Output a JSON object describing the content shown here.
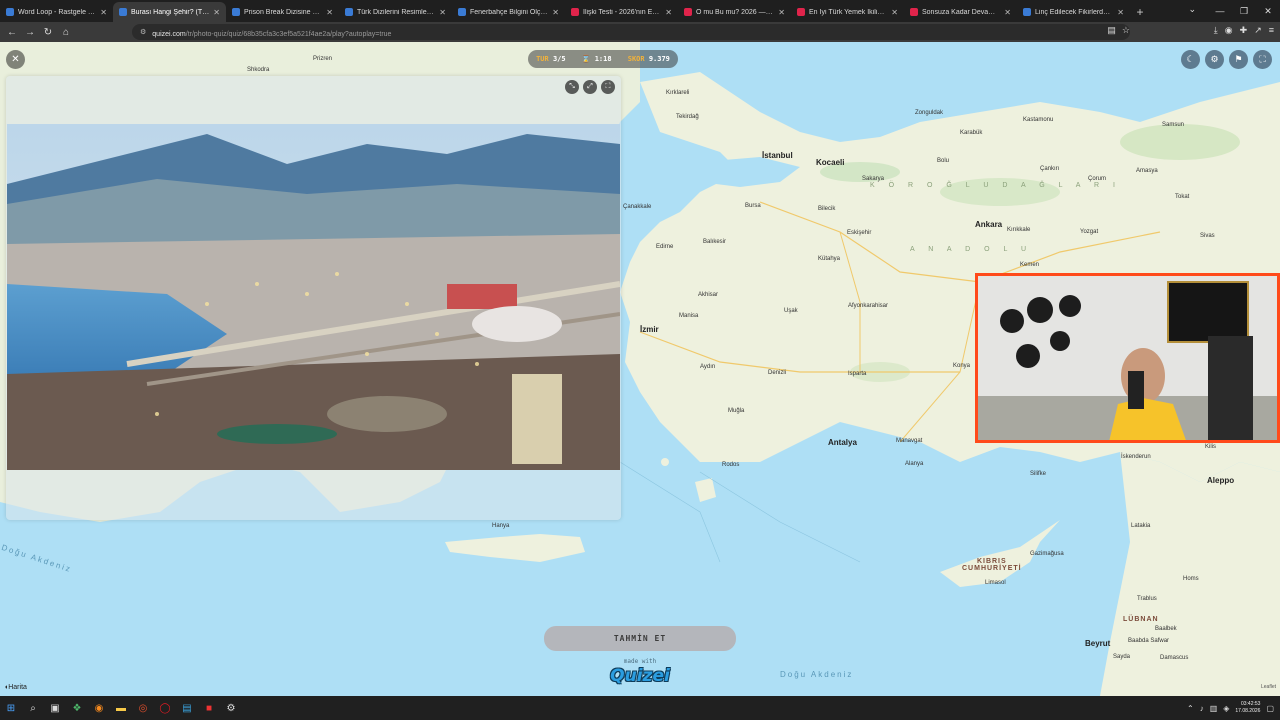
{
  "browser": {
    "tabs": [
      {
        "title": "Word Loop - Rastgele - Quizei",
        "color": "#3a7bd5",
        "active": false
      },
      {
        "title": "Burası Hangi Şehir? (Türkiye) - Q",
        "color": "#3a7bd5",
        "active": true
      },
      {
        "title": "Prison Break Dizisine Ne Kadar",
        "color": "#3a7bd5",
        "active": false
      },
      {
        "title": "Türk Dizilerini Resimlerden Tah",
        "color": "#3a7bd5",
        "active": false
      },
      {
        "title": "Fenerbahçe Bilgini Ölç - Quizei",
        "color": "#3a7bd5",
        "active": false
      },
      {
        "title": "İlişki Testi - 2026'nın En Viral Te",
        "color": "#e0244b",
        "active": false
      },
      {
        "title": "O mu Bu mu? 2026 — Sevgilini",
        "color": "#e0244b",
        "active": false
      },
      {
        "title": "En İyi Türk Yemek İkilisi Hangisi",
        "color": "#e0244b",
        "active": false
      },
      {
        "title": "Sonsuza Kadar Devam Edecek",
        "color": "#e0244b",
        "active": false
      },
      {
        "title": "Linç Edilecek Fikirlerden Hangi",
        "color": "#3a7bd5",
        "active": false
      }
    ],
    "url_host": "quizei.com",
    "url_path": "/tr/photo-quiz/quiz/68b35cfa3c3ef5a521f4ae2a/play?autoplay=true"
  },
  "hud": {
    "round_label": "TUR",
    "round_value": "3/5",
    "timer_value": "1:18",
    "score_label": "SKOR",
    "score_value": "9.379"
  },
  "guess_button": "TAHMİN ET",
  "made_with": "made with",
  "logo_text": "Quizei",
  "map_tab": "Harita",
  "attribution": "Leaflet",
  "map_labels": {
    "istanbul": "İstanbul",
    "kocaeli": "Kocaeli",
    "ankara": "Ankara",
    "izmir": "İzmir",
    "antalya": "Antalya",
    "bursa": "Bursa",
    "eskisehir": "Eskişehir",
    "balikesir": "Balıkesir",
    "konya": "Konya",
    "denizli": "Denizli",
    "aydin": "Aydın",
    "mugla": "Muğla",
    "rodos": "Rodos",
    "samsun": "Samsun",
    "aleppo": "Aleppo",
    "beyrut": "Beyrut",
    "kutahya": "Kütahya",
    "afyon": "Afyonkarahisar",
    "manisa": "Manisa",
    "edirne": "Edirne",
    "kastamonu": "Kastamonu",
    "zonguldak": "Zonguldak",
    "corum": "Çorum",
    "amasya": "Amasya",
    "tokat": "Tokat",
    "sivas": "Sivas",
    "yozgat": "Yozgat",
    "canakkale": "Çanakkale",
    "tekirdag": "Tekirdağ",
    "kirklareli": "Kırklareli",
    "isparta": "Isparta",
    "alanya": "Alanya",
    "hanya": "Hanya",
    "latakia": "Latakia",
    "homs": "Homs",
    "damascus": "Damascus",
    "limasol": "Limasol",
    "girne": "Gazimağusa",
    "iskenderun": "İskenderun",
    "kilis": "Kilis",
    "silifke": "Silifke",
    "manavgat": "Manavgat",
    "usak": "Uşak",
    "bolu": "Bolu",
    "sakarya": "Sakarya",
    "karabuk": "Karabük",
    "cankiri": "Çankırı",
    "kirikkale": "Kırıkkale",
    "bilecik": "Bilecik",
    "kemen": "Kemen",
    "akhisar": "Akhisar",
    "prizren": "Prizren",
    "skodra": "Shkodra",
    "mersin_sea": "Doğu Akdeniz",
    "west_sea": "Doğu Akdeniz",
    "region": "K Ö R O Ğ L U  D A Ğ L A R I",
    "anadolu": "A N A D O L U",
    "cyprus1": "KIBRIS",
    "cyprus2": "CUMHURİYETİ",
    "lebanon": "LÜBNAN",
    "trablus": "Trablus",
    "baalbek": "Baalbek",
    "sayda": "Sayda",
    "baabda": "Baabda Safwar"
  },
  "colors": {
    "accent": "#ff4a1a",
    "hud_label": "#f2b23a",
    "sea": "#aedff5",
    "land": "#e9efdc"
  }
}
